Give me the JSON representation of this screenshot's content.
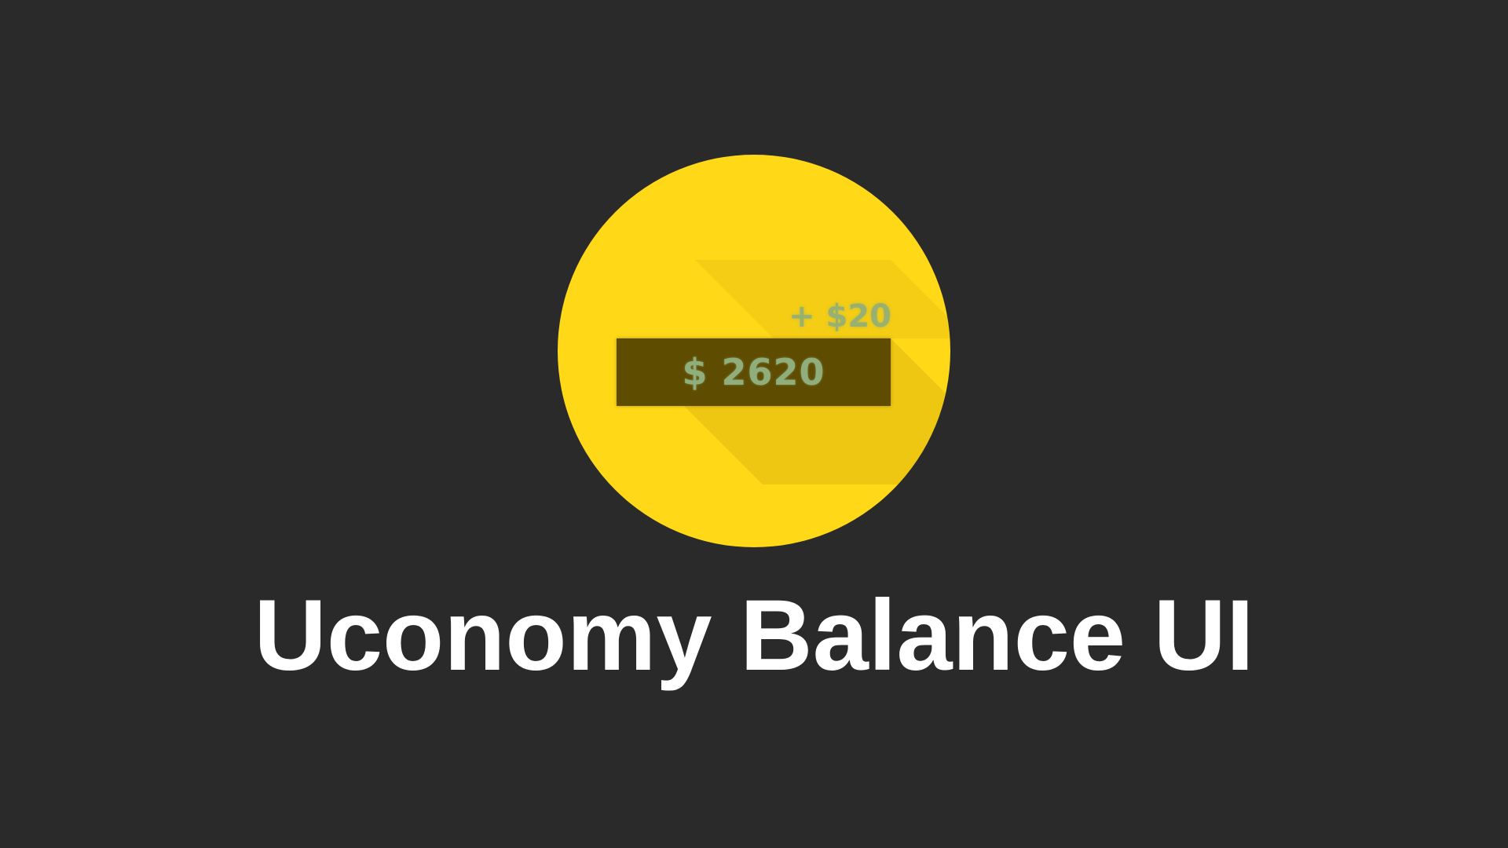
{
  "balance": {
    "amount_label": "$ 2620",
    "delta_label": "+ $20"
  },
  "title": "Uconomy Balance UI",
  "colors": {
    "background": "#2a2a2a",
    "coin": "#ffd817",
    "bar": "#5e4c00",
    "amount_text": "#8fae7c",
    "title_text": "#ffffff"
  }
}
